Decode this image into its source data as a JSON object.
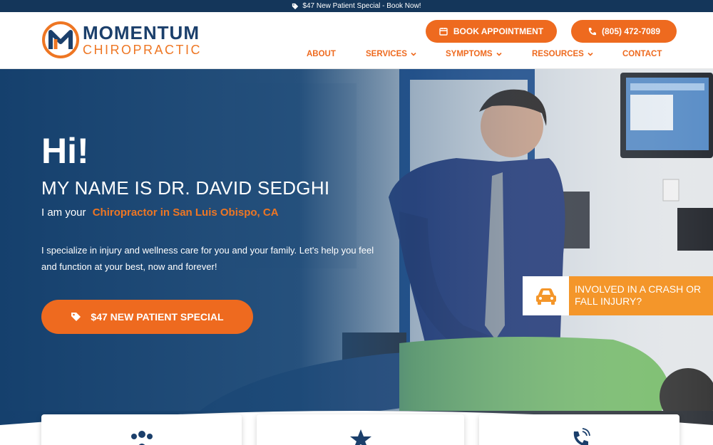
{
  "topbar": {
    "text": "$47 New Patient Special - Book Now!",
    "icon": "tag-icon"
  },
  "logo": {
    "line1": "MOMENTUM",
    "line2": "CHIROPRACTIC",
    "mark_letter": "M"
  },
  "header": {
    "book_label": "BOOK APPOINTMENT",
    "phone_label": "(805) 472-7089"
  },
  "nav": {
    "items": [
      {
        "label": "ABOUT",
        "dropdown": false
      },
      {
        "label": "SERVICES",
        "dropdown": true
      },
      {
        "label": "SYMPTOMS",
        "dropdown": true
      },
      {
        "label": "RESOURCES",
        "dropdown": true
      },
      {
        "label": "CONTACT",
        "dropdown": false
      }
    ]
  },
  "hero": {
    "greeting": "Hi!",
    "name_line": "MY NAME IS DR. DAVID SEDGHI",
    "sub_prefix": "I am your",
    "sub_accent": "Chiropractor in San Luis Obispo, CA",
    "description": "I specialize in injury and wellness care for you and your family. Let's help you feel and function at your best, now and forever!",
    "cta_label": "$47 NEW PATIENT SPECIAL"
  },
  "crash_banner": {
    "line1": "INVOLVED IN A CRASH OR",
    "line2": "FALL INJURY?",
    "icon": "car-icon"
  },
  "cards": [
    {
      "icon": "people-icon"
    },
    {
      "icon": "star-icon"
    },
    {
      "icon": "phone-icon"
    }
  ],
  "colors": {
    "brand_navy": "#14365a",
    "brand_orange": "#ee6a1f",
    "banner_orange": "#f4962a"
  }
}
